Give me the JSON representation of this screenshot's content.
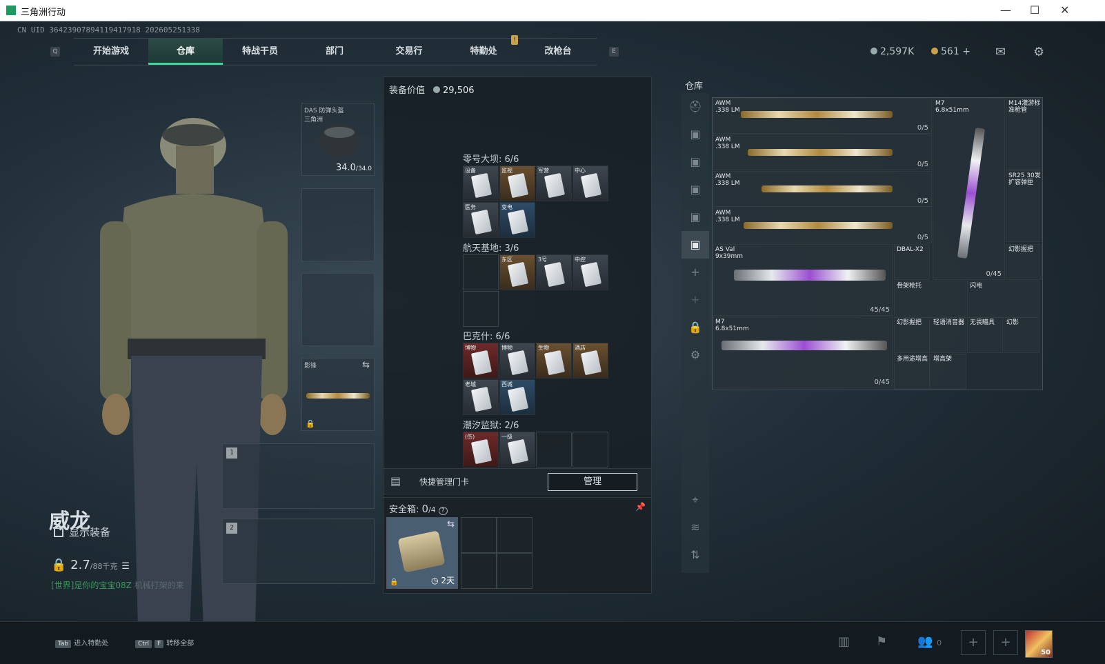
{
  "window": {
    "title": "三角洲行动",
    "controls": [
      "—",
      "☐",
      "✕"
    ]
  },
  "uid": "CN UID 3642390789411941791​8 202605251338",
  "nav": {
    "left_key": "Q",
    "right_key": "E",
    "badge": "!",
    "tabs": [
      "开始游戏",
      "仓库",
      "特战干员",
      "部门",
      "交易行",
      "特勤处",
      "改枪台"
    ],
    "active": 1
  },
  "currency": {
    "coins": "2,597K",
    "tickets": "561",
    "plus": "+"
  },
  "character": {
    "name": "威龙",
    "show_gear_label": "显示装备",
    "weight": "2.7",
    "weight_max": "/88千克"
  },
  "chat": {
    "channel": "[世界]",
    "text": "是你的宝宝08Z",
    "tail": "机械打架的来"
  },
  "gear": {
    "helmet": {
      "name": "DAS 防弹头盔",
      "sub": "三角洲",
      "durability": "34.0",
      "durability_max": "/34.0"
    },
    "secondary": {
      "name": "影锋"
    },
    "slot1": "1",
    "slot2": "2"
  },
  "center": {
    "value_label": "装备价值",
    "value": "29,506",
    "sections": [
      {
        "title": "零号大坝: 6/6",
        "cards": [
          "设备",
          "监视",
          "军营",
          "中心",
          "医务",
          "变电"
        ]
      },
      {
        "title": "航天基地: 3/6",
        "cards": [
          "东区",
          "3号",
          "中控"
        ]
      },
      {
        "title": "巴克什: 6/6",
        "cards": [
          "博物",
          "博物",
          "生物",
          "酒店",
          "老城",
          "西城"
        ]
      },
      {
        "title": "潮汐监狱: 2/6",
        "cards": [
          "(伤)",
          "一级"
        ]
      }
    ],
    "manage_label": "快捷管理门卡",
    "manage_btn": "管理",
    "safe_label": "安全箱:",
    "safe_count": "0",
    "safe_max": "/4",
    "safe_help": "?",
    "safe_time": "2天"
  },
  "storage": {
    "title": "仓库",
    "weapons": [
      {
        "name": "AWM",
        "cal": ".338 LM",
        "count": "0/5"
      },
      {
        "name": "AWM",
        "cal": ".338 LM",
        "count": "0/5"
      },
      {
        "name": "AWM",
        "cal": ".338 LM",
        "count": "0/5"
      },
      {
        "name": "AWM",
        "cal": ".338 LM",
        "count": "0/5"
      },
      {
        "name": "AS Val",
        "cal": "9x39mm",
        "count": "45/45"
      },
      {
        "name": "M7",
        "cal": "6.8x51mm",
        "count": "0/45"
      },
      {
        "name": "M7",
        "cal": "6.8x51mm",
        "count": "0/45"
      }
    ],
    "attachments": [
      "M14灌游标准枪管",
      "SR25 30发扩容弹匣",
      "DBAL-X2",
      "幻影握把",
      "骨架枪托",
      "闪电",
      "幻影握把",
      "轻语消音器",
      "无畏瞄具",
      "幻影",
      "多用途增高",
      "增高架"
    ]
  },
  "bottom": {
    "hint1_key": "Tab",
    "hint1": "进入特勤处",
    "hint2_keys": [
      "Ctrl",
      "F"
    ],
    "hint2": "转移全部",
    "friends": "0",
    "level": "50"
  }
}
